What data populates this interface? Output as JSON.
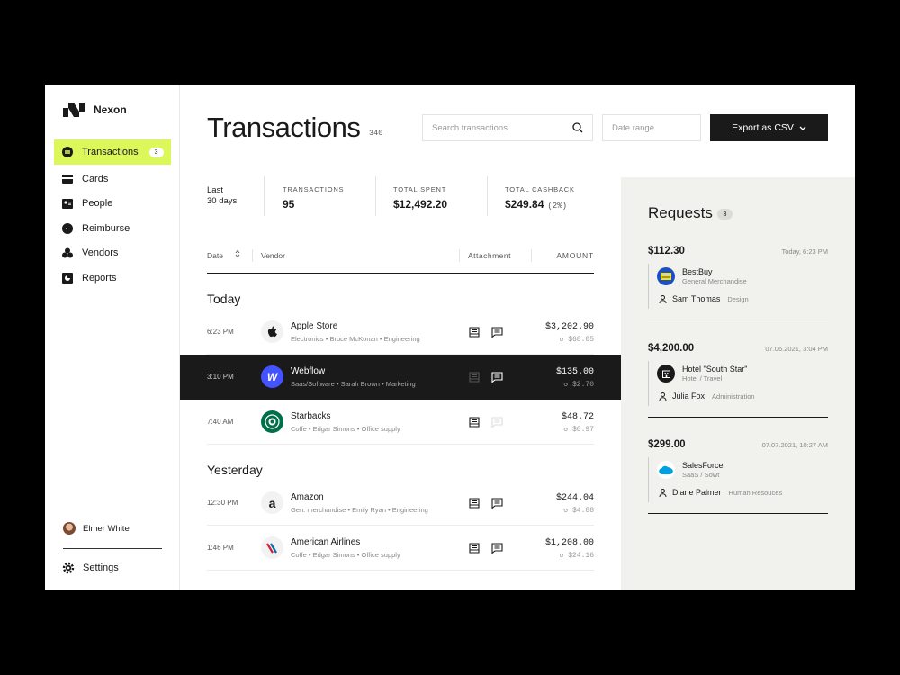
{
  "app": {
    "name": "Nexon"
  },
  "sidebar": {
    "items": [
      {
        "label": "Transactions",
        "badge": "3",
        "icon": "transactions-icon"
      },
      {
        "label": "Cards",
        "icon": "card-icon"
      },
      {
        "label": "People",
        "icon": "people-icon"
      },
      {
        "label": "Reimburse",
        "icon": "reimburse-icon"
      },
      {
        "label": "Vendors",
        "icon": "vendors-icon"
      },
      {
        "label": "Reports",
        "icon": "reports-icon"
      }
    ],
    "user": "Elmer White",
    "settings": "Settings"
  },
  "header": {
    "title": "Transactions",
    "count": "340",
    "search_placeholder": "Search transactions",
    "date_placeholder": "Date range",
    "export_label": "Export as CSV"
  },
  "stats": {
    "period_line1": "Last",
    "period_line2": "30 days",
    "transactions_label": "TRANSACTIONS",
    "transactions_value": "95",
    "spent_label": "TOTAL SPENT",
    "spent_value": "$12,492.20",
    "cashback_label": "TOTAL CASHBACK",
    "cashback_value": "$249.84",
    "cashback_pct": "(2%)"
  },
  "table": {
    "col_date": "Date",
    "col_vendor": "Vendor",
    "col_attachment": "Attachment",
    "col_amount": "AMOUNT",
    "groups": [
      {
        "label": "Today"
      },
      {
        "label": "Yesterday"
      }
    ],
    "rows": [
      {
        "time": "6:23 PM",
        "vendor": "Apple Store",
        "meta": "Electronics • Bruce McKonan • Engineering",
        "amount": "$3,202.90",
        "cashback": "$68.05"
      },
      {
        "time": "3:10 PM",
        "vendor": "Webflow",
        "meta": "Saas/Software • Sarah Brown • Marketing",
        "amount": "$135.00",
        "cashback": "$2.70",
        "logo_text": "W"
      },
      {
        "time": "7:40 AM",
        "vendor": "Starbacks",
        "meta": "Coffe • Edgar Simons • Office supply",
        "amount": "$48.72",
        "cashback": "$0.97"
      },
      {
        "time": "12:30 PM",
        "vendor": "Amazon",
        "meta": "Gen. merchandise • Emily Ryan • Engineering",
        "amount": "$244.04",
        "cashback": "$4.88",
        "logo_text": "a"
      },
      {
        "time": "1:46 PM",
        "vendor": "American Airlines",
        "meta": "Coffe • Edgar Simons • Office supply",
        "amount": "$1,208.00",
        "cashback": "$24.16"
      }
    ]
  },
  "requests": {
    "title": "Requests",
    "count": "3",
    "items": [
      {
        "amount": "$112.30",
        "date": "Today, 6:23 PM",
        "vendor": "BestBuy",
        "category": "General Merchandise",
        "person": "Sam Thomas",
        "dept": "Design"
      },
      {
        "amount": "$4,200.00",
        "date": "07.06.2021, 3:04 PM",
        "vendor": "Hotel \"South Star\"",
        "category": "Hotel / Travel",
        "person": "Julia Fox",
        "dept": "Administration"
      },
      {
        "amount": "$299.00",
        "date": "07.07.2021, 10:27 AM",
        "vendor": "SalesForce",
        "category": "SaaS / Sowt",
        "person": "Diane Palmer",
        "dept": "Human Resouces"
      }
    ]
  },
  "colors": {
    "accent": "#dcf75a",
    "dark": "#1a1a1a",
    "panel": "#f1f1ed"
  }
}
